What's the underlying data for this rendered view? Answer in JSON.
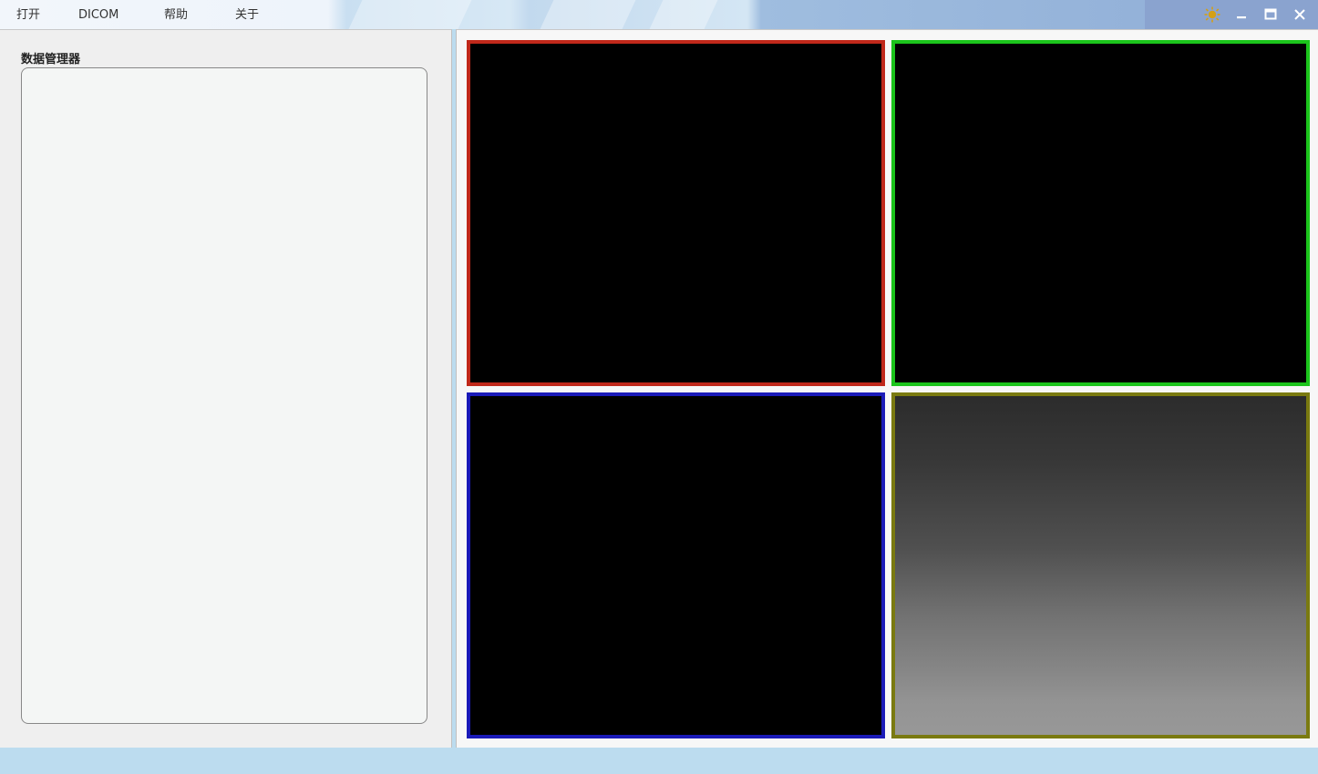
{
  "menu": {
    "items": [
      {
        "label": "打开"
      },
      {
        "label": "DICOM"
      },
      {
        "label": "帮助"
      },
      {
        "label": "关于"
      }
    ]
  },
  "window_controls": {
    "theme_icon": "sun-icon",
    "minimize_icon": "minimize-icon",
    "maximize_icon": "maximize-icon",
    "close_icon": "close-icon"
  },
  "sidebar": {
    "title": "数据管理器"
  },
  "viewports": [
    {
      "name": "top-left",
      "border_color": "#c0281a"
    },
    {
      "name": "top-right",
      "border_color": "#1bc41b"
    },
    {
      "name": "bottom-left",
      "border_color": "#1a1ab8"
    },
    {
      "name": "bottom-right",
      "border_color": "#7a7a10"
    }
  ],
  "colors": {
    "accent_sun": "#d4a015",
    "statusbar": "#bcdcef"
  }
}
